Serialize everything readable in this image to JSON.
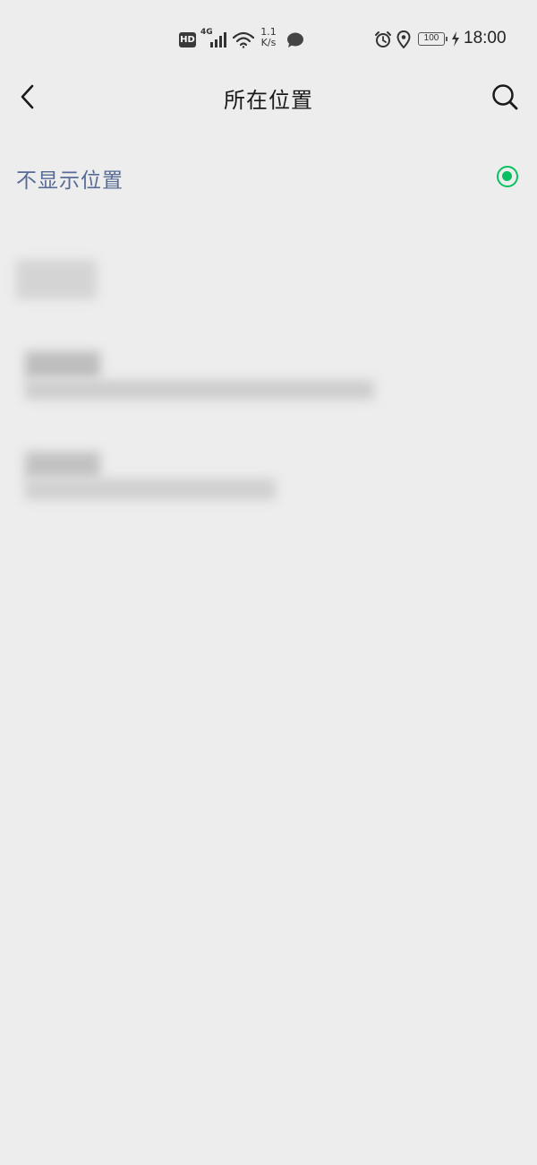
{
  "status_bar": {
    "hd": "HD",
    "network": "4G",
    "speed_value": "1.1",
    "speed_unit": "K/s",
    "battery": "100",
    "time": "18:00"
  },
  "nav": {
    "title": "所在位置"
  },
  "option": {
    "label": "不显示位置",
    "selected": true,
    "accent_color": "#07c160",
    "label_color": "#576b95"
  },
  "icons": {
    "back": "chevron-left-icon",
    "search": "search-icon"
  }
}
